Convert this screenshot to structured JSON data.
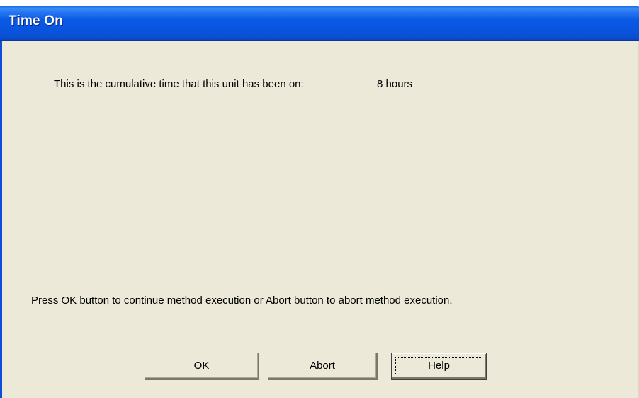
{
  "window": {
    "title": "Time On"
  },
  "info": {
    "description": "This is the cumulative time that this unit has been on:",
    "value": "8 hours"
  },
  "instruction": "Press OK button to continue method execution or Abort button to abort method execution.",
  "buttons": {
    "ok_label": "OK",
    "abort_label": "Abort",
    "help_label": "Help"
  },
  "colors": {
    "titlebar": "#0a5ae6",
    "dialog_background": "#ece9d8",
    "title_text": "#ffffff"
  }
}
